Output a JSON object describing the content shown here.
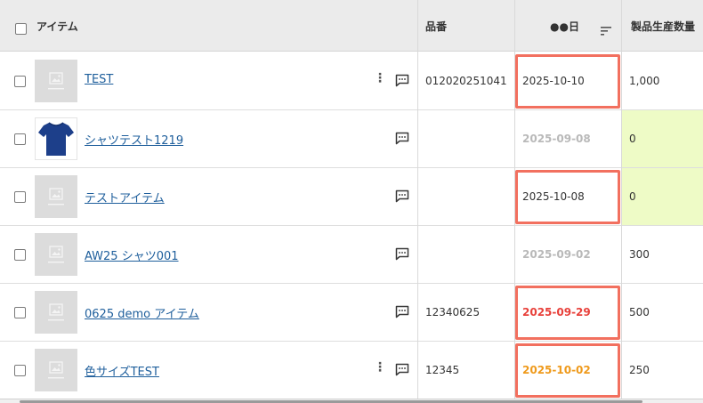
{
  "header": {
    "item": "アイテム",
    "part_no": "品番",
    "date": "●●日",
    "qty": "製品生産数量"
  },
  "colors": {
    "highlight_border": "#f2705f",
    "date_red": "#e8413b",
    "date_orange": "#ef9a1c",
    "date_grey": "#b9b9b9",
    "qty_highlight": "#eefbc6",
    "link": "#1f5f9c"
  },
  "rows": [
    {
      "name": "TEST",
      "part_no": "012020251041",
      "date": "2025-10-10",
      "date_style": "normal",
      "qty": "1,000",
      "more_icon": "more-vertical-icon",
      "comment_icon": "comment-icon",
      "thumb": "placeholder",
      "highlighted": true,
      "qty_highlight": false
    },
    {
      "name": "シャツテスト1219",
      "part_no": "",
      "date": "2025-09-08",
      "date_style": "grey",
      "qty": "0",
      "comment_icon": "comment-icon",
      "thumb": "tshirt",
      "highlighted": false,
      "qty_highlight": true
    },
    {
      "name": "テストアイテム",
      "part_no": "",
      "date": "2025-10-08",
      "date_style": "normal",
      "qty": "0",
      "comment_icon": "comment-icon",
      "thumb": "placeholder",
      "highlighted": true,
      "qty_highlight": true
    },
    {
      "name": "AW25 シャツ001",
      "part_no": "",
      "date": "2025-09-02",
      "date_style": "grey",
      "qty": "300",
      "comment_icon": "comment-icon",
      "thumb": "placeholder",
      "highlighted": false,
      "qty_highlight": false
    },
    {
      "name": "0625 demo アイテム",
      "part_no": "12340625",
      "date": "2025-09-29",
      "date_style": "red",
      "qty": "500",
      "comment_icon": "comment-icon",
      "thumb": "placeholder",
      "highlighted": true,
      "qty_highlight": false
    },
    {
      "name": "色サイズTEST",
      "part_no": "12345",
      "date": "2025-10-02",
      "date_style": "orange",
      "qty": "250",
      "more_icon": "more-vertical-icon",
      "comment_icon": "comment-icon",
      "thumb": "placeholder",
      "highlighted": true,
      "qty_highlight": false
    }
  ]
}
